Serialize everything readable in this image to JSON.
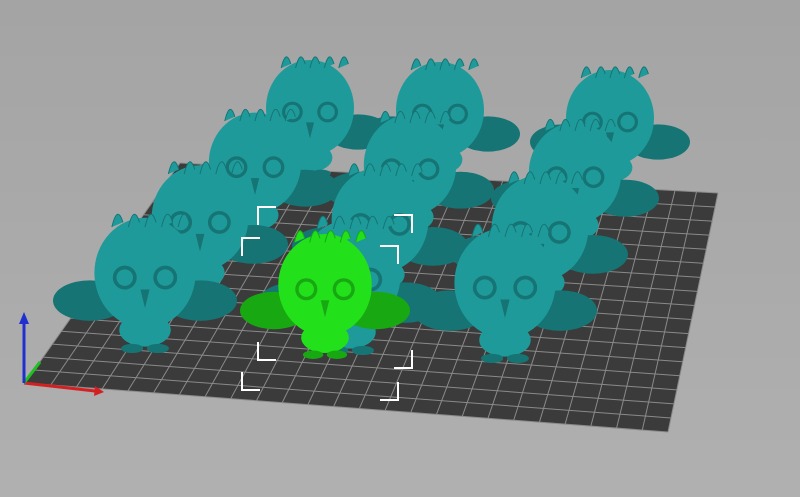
{
  "viewport": {
    "background_color": "#a9a9a9",
    "bed_color": "#3b3b3b",
    "bed_grid_color": "#8a8a8a",
    "object_color": "#1f9a9a",
    "object_shade_color": "#167474",
    "selected_object_color": "#22e01a",
    "selection_box_color": "#ffffff"
  },
  "axes": {
    "x_color": "#d42020",
    "y_color": "#20c020",
    "z_color": "#2030d0"
  },
  "objects": [
    {
      "id": "owl-left",
      "selected": false
    },
    {
      "id": "owl-middle",
      "selected": false
    },
    {
      "id": "owl-right",
      "selected": false
    },
    {
      "id": "owl-selected",
      "selected": true
    }
  ]
}
